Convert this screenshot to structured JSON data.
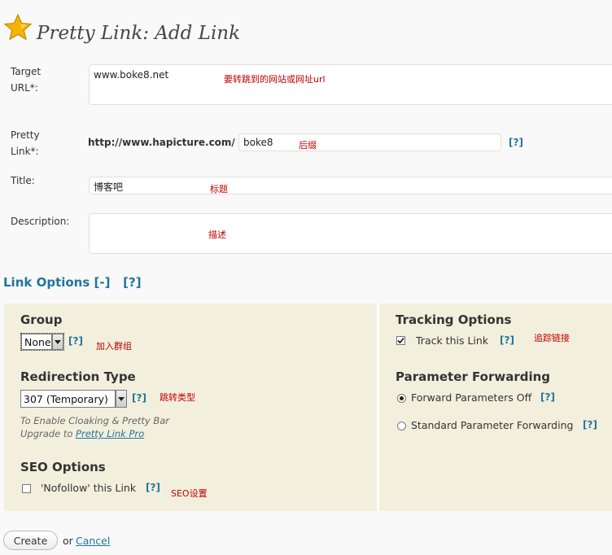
{
  "page": {
    "title": "Pretty Link: Add Link"
  },
  "form": {
    "target_url_label_line1": "Target",
    "target_url_label_line2": "URL*:",
    "target_url_value": "www.boke8.net",
    "target_url_note": "要转跳到的网站或网址url",
    "pretty_link_label_line1": "Pretty",
    "pretty_link_label_line2": "Link*:",
    "pretty_link_prefix": "http://www.hapicture.com/",
    "pretty_link_value": "boke8",
    "pretty_link_note": "后缀",
    "pretty_link_help": "[?]",
    "title_label": "Title:",
    "title_value": "博客吧",
    "title_note": "标题",
    "description_label": "Description:",
    "description_value": "",
    "description_note": "描述"
  },
  "link_options": {
    "heading": "Link Options",
    "collapse_toggle": "[-]",
    "help": "[?]"
  },
  "left_panel": {
    "group_heading": "Group",
    "group_selected": "None",
    "group_help": "[?]",
    "group_note": "加入群组",
    "redirection_heading": "Redirection Type",
    "redirection_selected": "307 (Temporary)",
    "redirection_help": "[?]",
    "redirection_note": "跳转类型",
    "cloaking_note_line1": "To Enable Cloaking & Pretty Bar",
    "cloaking_note_prefix": "Upgrade to ",
    "cloaking_note_link": "Pretty Link Pro",
    "seo_heading": "SEO Options",
    "nofollow_label": "'Nofollow' this Link",
    "nofollow_checked": false,
    "nofollow_help": "[?]",
    "seo_note": "SEO设置"
  },
  "right_panel": {
    "tracking_heading": "Tracking Options",
    "track_label": "Track this Link",
    "track_checked": true,
    "track_help": "[?]",
    "track_note": "追踪链接",
    "param_heading": "Parameter Forwarding",
    "param_off_label": "Forward Parameters Off",
    "param_off_help": "[?]",
    "param_off_selected": true,
    "param_standard_label": "Standard Parameter Forwarding",
    "param_standard_help": "[?]",
    "param_standard_selected": false
  },
  "actions": {
    "create_label": "Create",
    "or_text": "or",
    "cancel_label": "Cancel"
  },
  "colors": {
    "accent": "#21759b",
    "annotation": "#c00000",
    "panel_bg": "#f2efdd",
    "star": "#f5b400"
  },
  "icons": {
    "title_icon": "star-icon",
    "dropdown_arrow": "chevron-down-icon",
    "checkmark": "checkmark-icon"
  }
}
